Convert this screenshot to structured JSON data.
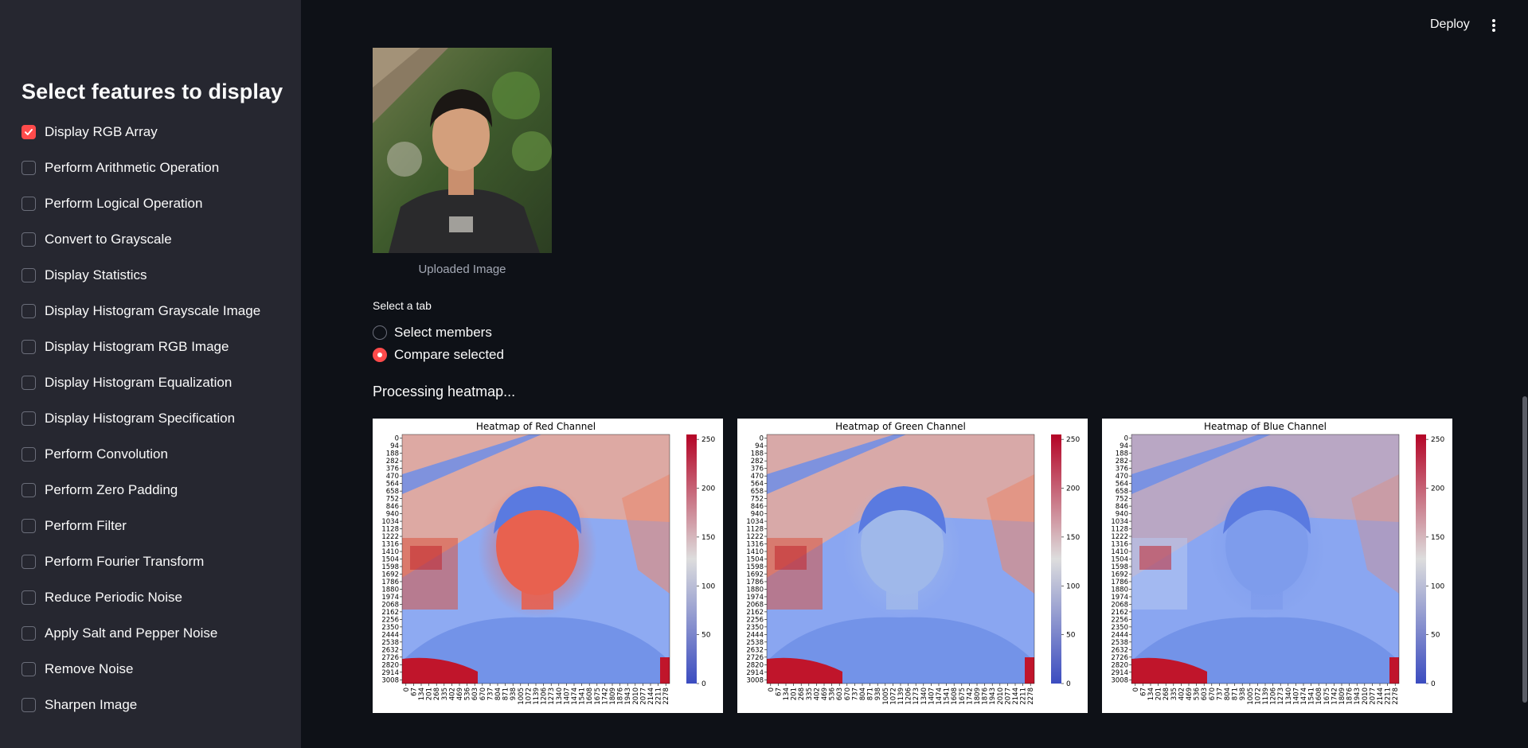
{
  "sidebar": {
    "title": "Select features to display",
    "items": [
      {
        "label": "Display RGB Array",
        "checked": true
      },
      {
        "label": "Perform Arithmetic Operation",
        "checked": false
      },
      {
        "label": "Perform Logical Operation",
        "checked": false
      },
      {
        "label": "Convert to Grayscale",
        "checked": false
      },
      {
        "label": "Display Statistics",
        "checked": false
      },
      {
        "label": "Display Histogram Grayscale Image",
        "checked": false
      },
      {
        "label": "Display Histogram RGB Image",
        "checked": false
      },
      {
        "label": "Display Histogram Equalization",
        "checked": false
      },
      {
        "label": "Display Histogram Specification",
        "checked": false
      },
      {
        "label": "Perform Convolution",
        "checked": false
      },
      {
        "label": "Perform Zero Padding",
        "checked": false
      },
      {
        "label": "Perform Filter",
        "checked": false
      },
      {
        "label": "Perform Fourier Transform",
        "checked": false
      },
      {
        "label": "Reduce Periodic Noise",
        "checked": false
      },
      {
        "label": "Apply Salt and Pepper Noise",
        "checked": false
      },
      {
        "label": "Remove Noise",
        "checked": false
      },
      {
        "label": "Sharpen Image",
        "checked": false
      }
    ]
  },
  "header": {
    "deploy_label": "Deploy",
    "menu_icon": "kebab-menu-icon"
  },
  "main": {
    "image_caption": "Uploaded Image",
    "tab_select": {
      "label": "Select a tab",
      "options": [
        {
          "label": "Select members",
          "selected": false
        },
        {
          "label": "Compare selected",
          "selected": true
        }
      ]
    },
    "status_text": "Processing heatmap..."
  },
  "chart_data": [
    {
      "type": "heatmap",
      "title": "Heatmap of Red Channel",
      "colormap": "coolwarm",
      "y_ticks": [
        0,
        94,
        188,
        282,
        376,
        470,
        564,
        658,
        752,
        846,
        940,
        1034,
        1128,
        1222,
        1316,
        1410,
        1504,
        1598,
        1692,
        1786,
        1880,
        1974,
        2068,
        2162,
        2256,
        2350,
        2444,
        2538,
        2632,
        2726,
        2820,
        2914,
        3008
      ],
      "x_ticks": [
        0,
        67,
        134,
        201,
        268,
        335,
        402,
        469,
        536,
        603,
        670,
        737,
        804,
        871,
        938,
        1005,
        1072,
        1139,
        1206,
        1273,
        1340,
        1407,
        1474,
        1541,
        1608,
        1675,
        1742,
        1809,
        1876,
        1943,
        2010,
        2077,
        2144,
        2211,
        2278
      ],
      "colorbar_ticks": [
        0,
        50,
        100,
        150,
        200,
        250
      ],
      "colorbar_range": [
        0,
        255
      ]
    },
    {
      "type": "heatmap",
      "title": "Heatmap of Green Channel",
      "colormap": "coolwarm",
      "y_ticks": [
        0,
        94,
        188,
        282,
        376,
        470,
        564,
        658,
        752,
        846,
        940,
        1034,
        1128,
        1222,
        1316,
        1410,
        1504,
        1598,
        1692,
        1786,
        1880,
        1974,
        2068,
        2162,
        2256,
        2350,
        2444,
        2538,
        2632,
        2726,
        2820,
        2914,
        3008
      ],
      "x_ticks": [
        0,
        67,
        134,
        201,
        268,
        335,
        402,
        469,
        536,
        603,
        670,
        737,
        804,
        871,
        938,
        1005,
        1072,
        1139,
        1206,
        1273,
        1340,
        1407,
        1474,
        1541,
        1608,
        1675,
        1742,
        1809,
        1876,
        1943,
        2010,
        2077,
        2144,
        2211,
        2278
      ],
      "colorbar_ticks": [
        0,
        50,
        100,
        150,
        200,
        250
      ],
      "colorbar_range": [
        0,
        255
      ]
    },
    {
      "type": "heatmap",
      "title": "Heatmap of Blue Channel",
      "colormap": "coolwarm",
      "y_ticks": [
        0,
        94,
        188,
        282,
        376,
        470,
        564,
        658,
        752,
        846,
        940,
        1034,
        1128,
        1222,
        1316,
        1410,
        1504,
        1598,
        1692,
        1786,
        1880,
        1974,
        2068,
        2162,
        2256,
        2350,
        2444,
        2538,
        2632,
        2726,
        2820,
        2914,
        3008
      ],
      "x_ticks": [
        0,
        67,
        134,
        201,
        268,
        335,
        402,
        469,
        536,
        603,
        670,
        737,
        804,
        871,
        938,
        1005,
        1072,
        1139,
        1206,
        1273,
        1340,
        1407,
        1474,
        1541,
        1608,
        1675,
        1742,
        1809,
        1876,
        1943,
        2010,
        2077,
        2144,
        2211,
        2278
      ],
      "colorbar_ticks": [
        0,
        50,
        100,
        150,
        200,
        250
      ],
      "colorbar_range": [
        0,
        255
      ]
    }
  ],
  "colors": {
    "accent": "#ff4b4b",
    "sidebar_bg": "#262730",
    "main_bg": "#0e1117",
    "heat_low": "#3b4cc0",
    "heat_mid": "#dddddd",
    "heat_high": "#b40426"
  }
}
